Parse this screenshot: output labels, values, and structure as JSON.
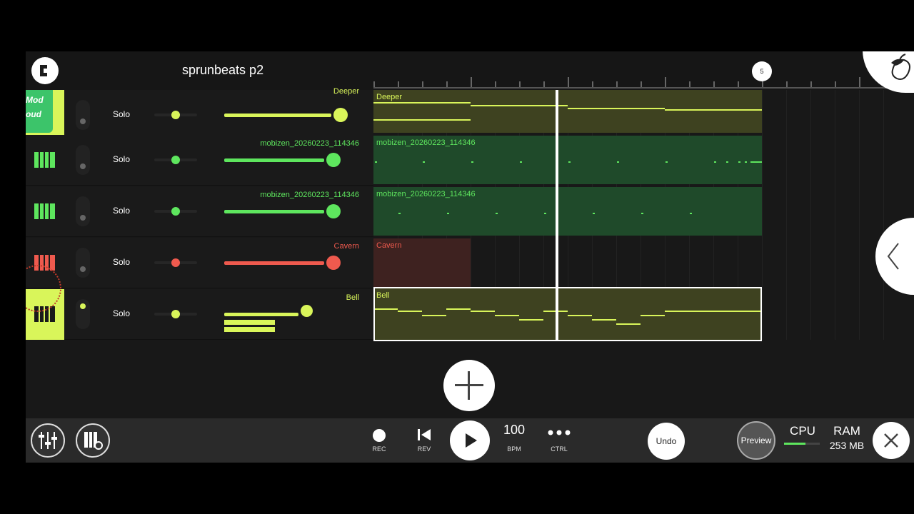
{
  "header": {
    "title": "sprunbeats p2",
    "marker": "5"
  },
  "watermark": "Mod\noud",
  "tracks": [
    {
      "name": "Deeper",
      "solo": "Solo",
      "color": "#d9f55a",
      "pattern": "Deeper"
    },
    {
      "name": "mobizen_20260223_114346",
      "solo": "Solo",
      "color": "#5ee65e",
      "pattern": "mobizen_20260223_114346"
    },
    {
      "name": "mobizen_20260223_114346",
      "solo": "Solo",
      "color": "#5ee65e",
      "pattern": "mobizen_20260223_114346"
    },
    {
      "name": "Cavern",
      "solo": "Solo",
      "color": "#ef5a4e",
      "pattern": "Cavern"
    },
    {
      "name": "Bell",
      "solo": "Solo",
      "color": "#d9f55a",
      "pattern": "Bell"
    }
  ],
  "transport": {
    "rec_label": "REC",
    "rev_label": "REV",
    "bpm_value": "100",
    "bpm_label": "BPM",
    "ctrl_label": "CTRL",
    "undo_label": "Undo",
    "preview_label": "Preview",
    "cpu_label": "CPU",
    "ram_label": "RAM",
    "ram_value": "253 MB"
  }
}
